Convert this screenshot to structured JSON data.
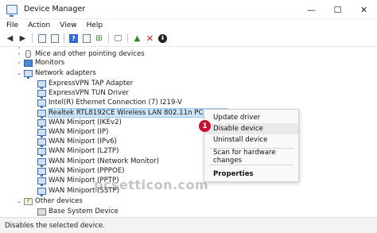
{
  "window": {
    "title": "Device Manager",
    "controls": [
      "—",
      "☐",
      "✕"
    ]
  },
  "menu": [
    "File",
    "Action",
    "View",
    "Help"
  ],
  "toolbar": {
    "icons": [
      "back-icon",
      "forward-icon",
      "properties-icon",
      "update-icon",
      "help-icon",
      "view-icon",
      "scan-icon",
      "monitor-icon",
      "enable-icon",
      "uninstall-icon",
      "download-icon"
    ]
  },
  "tree": {
    "partial_top": "",
    "mice": "Mice and other pointing devices",
    "monitors": "Monitors",
    "network_adapters": "Network adapters",
    "adapters": [
      "ExpressVPN TAP Adapter",
      "ExpressVPN TUN Driver",
      "Intel(R) Ethernet Connection (7) I219-V",
      "Realtek RTL8192CE Wireless LAN 802.11n PCI-E NIC",
      "WAN Miniport (IKEv2)",
      "WAN Miniport (IP)",
      "WAN Miniport (IPv6)",
      "WAN Miniport (L2TP)",
      "WAN Miniport (Network Monitor)",
      "WAN Miniport (PPPOE)",
      "WAN Miniport (PPTP)",
      "WAN Miniport (SSTP)"
    ],
    "other_devices": "Other devices",
    "base_system_device": "Base System Device"
  },
  "context_menu": {
    "update_driver": "Update driver",
    "disable_device": "Disable device",
    "uninstall_device": "Uninstall device",
    "scan": "Scan for hardware changes",
    "properties": "Properties",
    "step_badge": "1"
  },
  "watermark": "pcsetticon.com",
  "status": "Disables the selected device.",
  "colors": {
    "selection": "#cce4f7",
    "badge": "#c8102e",
    "network_icon": "#3b6fb0"
  }
}
